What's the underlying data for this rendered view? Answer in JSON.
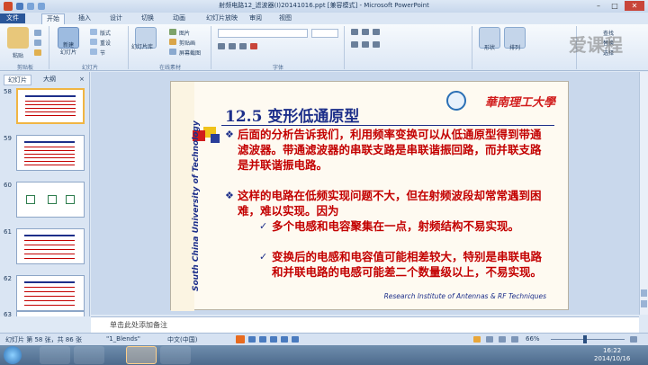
{
  "window": {
    "title": "射频电路12_滤波器(I)20141016.ppt [兼容模式] - Microsoft PowerPoint",
    "minimize": "–",
    "maximize": "□",
    "close": "✕"
  },
  "tabs": [
    {
      "label": "文件"
    },
    {
      "label": "开始"
    },
    {
      "label": "插入"
    },
    {
      "label": "设计"
    },
    {
      "label": "切换"
    },
    {
      "label": "动画"
    },
    {
      "label": "幻灯片放映"
    },
    {
      "label": "审阅"
    },
    {
      "label": "视图"
    }
  ],
  "ribbon": {
    "paste": "粘贴",
    "new_slide": "新建\n幻灯片",
    "layout": "版式",
    "reset": "重设",
    "section": "节",
    "slide_library": "幻灯片库",
    "picture": "图片",
    "clip_art": "剪贴画",
    "screenshot": "屏幕截图",
    "shape": "形状",
    "arrange": "排列",
    "find": "查找",
    "replace": "替换",
    "select": "选择",
    "groups": {
      "clipboard": "剪贴板",
      "slides": "幻灯片",
      "online_material": "在线素材",
      "font": "字体"
    }
  },
  "left_panel": {
    "tab_slides": "幻灯片",
    "tab_outline": "大纲",
    "close": "×",
    "thumbnails": [
      {
        "num": "58"
      },
      {
        "num": "59"
      },
      {
        "num": "60"
      },
      {
        "num": "61"
      },
      {
        "num": "62"
      },
      {
        "num": "63"
      }
    ]
  },
  "slide": {
    "university_cn": "華南理工大學",
    "title": "12.5 变形低通原型",
    "bullets": [
      {
        "mark": "❖",
        "text": "后面的分析告诉我们，利用频率变换可以从低通原型得到带通滤波器。带通滤波器的串联支路是串联谐振回路，而并联支路是并联谐振电路。"
      },
      {
        "mark": "❖",
        "text": "这样的电路在低频实现问题不大，但在射频波段却常常遇到困难，难以实现。因为"
      }
    ],
    "subbullets": [
      {
        "mark": "✓",
        "text": "多个电感和电容聚集在一点，射频结构不易实现。"
      },
      {
        "mark": "✓",
        "text": "变换后的电感和电容值可能相差较大，特别是串联电路和并联电路的电感可能差二个数量级以上，不易实现。"
      }
    ],
    "vertical_label": "South China University of Technology",
    "footer": "Research Institute of Antennas & RF Techniques"
  },
  "notes": {
    "placeholder": "单击此处添加备注"
  },
  "statusbar": {
    "slide_count": "幻灯片 第 58 张，共 86 张",
    "theme": "\"1_Blends\"",
    "language": "中文(中国)",
    "zoom": "66%"
  },
  "taskbar": {
    "time": "16:22",
    "date": "2014/10/16"
  },
  "watermark": "爱课程",
  "colors": {
    "slide_red": "#c30000",
    "slide_blue": "#1d2f8a",
    "selection": "#f0b543"
  }
}
